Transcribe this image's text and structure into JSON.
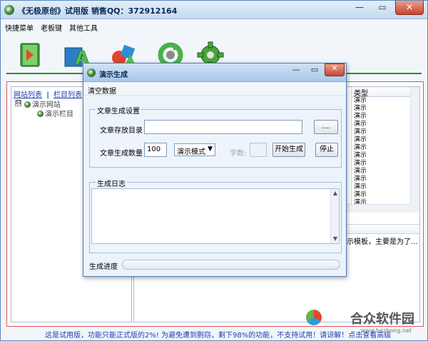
{
  "app": {
    "title": "《无极原创》试用版 销售QQ：372912164",
    "menu": [
      "快捷菜单",
      "老板键",
      "其他工具"
    ]
  },
  "window_controls": {
    "minimize": "—",
    "maximize": "▭",
    "close": "✕"
  },
  "tree": {
    "header_left": "网站列表",
    "header_sep": "|",
    "header_right": "栏目列表",
    "toggle": "⊟",
    "root": "演示网站",
    "child": "演示栏目"
  },
  "list": {
    "column_header": "类型",
    "rows": [
      "演示",
      "演示",
      "演示",
      "演示",
      "演示",
      "演示",
      "演示",
      "演示",
      "演示",
      "演示",
      "演示",
      "演示",
      "演示",
      "演示"
    ],
    "description": "示模板，主要是为了..."
  },
  "status_bar": {
    "text": "这是试用版，功能只能正式版的2%! 为避免遭到剽窃，剩下98%的功能，不支持试用！请谅解！点击查看高级",
    "watermark": "合众软件园",
    "watermark_url": "www.hezhong.net"
  },
  "dialog": {
    "title": "演示生成",
    "menu_item": "清空数据",
    "settings_group": "文章生成设置",
    "dir_label": "文章存放目录",
    "dir_value": "",
    "browse_button": "....",
    "count_label": "文章生成数量",
    "count_value": "100",
    "mode_value": "演示模式",
    "chars_label": "字数:",
    "start_button": "开始生成",
    "stop_button": "停止",
    "log_group": "生成日志",
    "progress_label": "生成进度",
    "progress": 0
  },
  "colors": {
    "accent_green": "#2c8c2c",
    "frame_red": "#d55",
    "title_blue": "#0a2a55",
    "link_blue": "#1a3fb0"
  }
}
